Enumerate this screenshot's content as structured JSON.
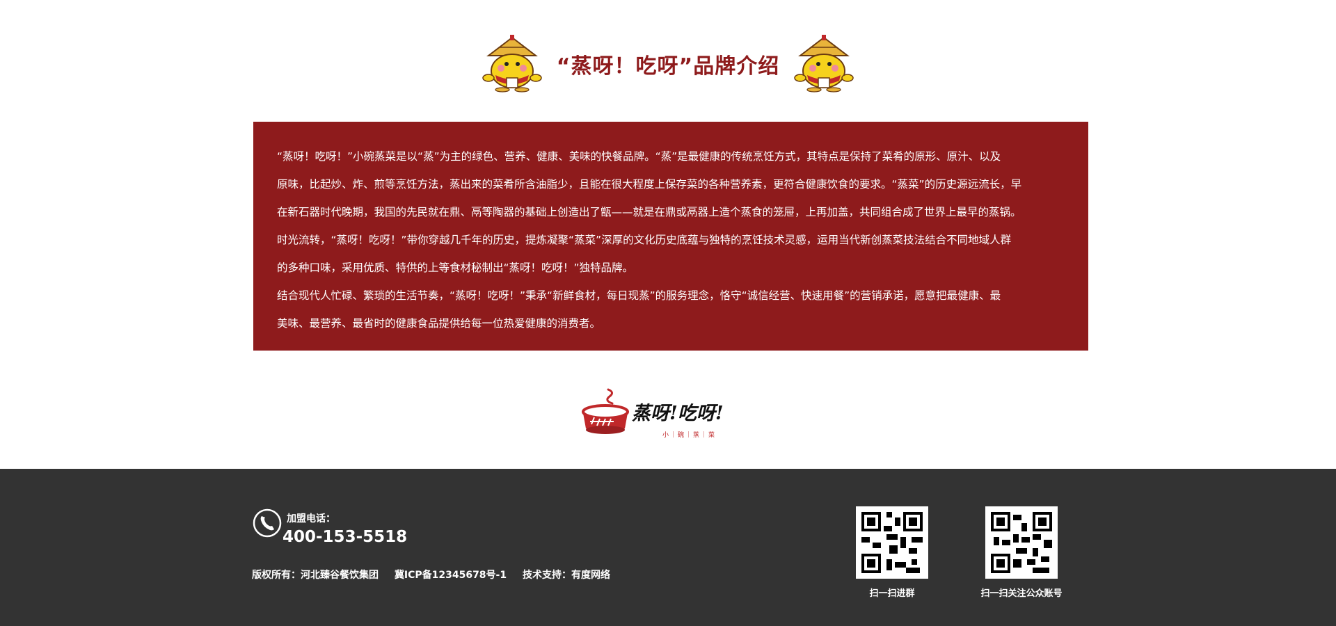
{
  "header": {
    "title": "“蒸呀！吃呀”品牌介绍",
    "mascot_icon": "steamed-bun-mascot-icon"
  },
  "intro": {
    "lines": [
      "“蒸呀！吃呀！”小碗蒸菜是以“蒸”为主的绿色、营养、健康、美味的快餐品牌。“蒸”是最健康的传统烹饪方式，其特点是保持了菜肴的原形、原汁、以及",
      "原味，比起炒、炸、煎等烹饪方法，蒸出来的菜肴所含油脂少，且能在很大程度上保存菜的各种营养素，更符合健康饮食的要求。“蒸菜”的历史源远流长，早",
      "在新石器时代晚期，我国的先民就在鼎、鬲等陶器的基础上创造出了甑——就是在鼎或鬲器上造个蒸食的笼屉，上再加盖，共同组合成了世界上最早的蒸锅。",
      "时光流转，“蒸呀！吃呀！”带你穿越几千年的历史，提炼凝聚“蒸菜”深厚的文化历史底蕴与独特的烹饪技术灵感，运用当代新创蒸菜技法结合不同地域人群",
      "的多种口味，采用优质、特供的上等食材秘制出“蒸呀！吃呀！”独特品牌。",
      "结合现代人忙碌、繁琐的生活节奏，“蒸呀！吃呀！”秉承“新鲜食材，每日现蒸”的服务理念，恪守“诚信经营、快速用餐”的营销承诺，愿意把最健康、最",
      "美味、最营养、最省时的健康食品提供给每一位热爱健康的消费者。"
    ]
  },
  "logo": {
    "name": "蒸呀!吃呀!",
    "tagline": "小｜碗｜蒸｜菜",
    "icon": "steamer-bowl-icon"
  },
  "footer": {
    "hotline_label": "加盟电话：",
    "hotline_number": "400-153-5518",
    "copyright": "版权所有：河北臻谷餐饮集团",
    "icp": "冀ICP备12345678号-1",
    "tech_support": "技术支持：有度网络",
    "qr_codes": [
      {
        "caption": "扫一扫进群"
      },
      {
        "caption": "扫一扫关注公众账号"
      }
    ]
  },
  "colors": {
    "brand_red": "#8e1b1c",
    "footer_bg": "#333333",
    "logo_red": "#c0282a"
  }
}
